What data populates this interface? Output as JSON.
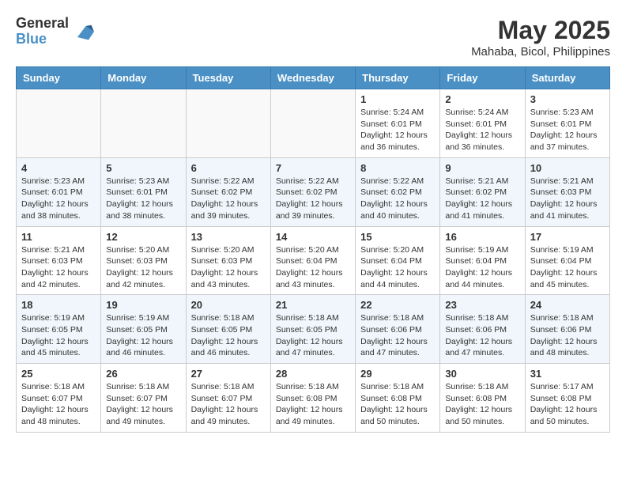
{
  "header": {
    "logo_general": "General",
    "logo_blue": "Blue",
    "month_title": "May 2025",
    "location": "Mahaba, Bicol, Philippines"
  },
  "weekdays": [
    "Sunday",
    "Monday",
    "Tuesday",
    "Wednesday",
    "Thursday",
    "Friday",
    "Saturday"
  ],
  "weeks": [
    [
      {
        "day": "",
        "info": ""
      },
      {
        "day": "",
        "info": ""
      },
      {
        "day": "",
        "info": ""
      },
      {
        "day": "",
        "info": ""
      },
      {
        "day": "1",
        "info": "Sunrise: 5:24 AM\nSunset: 6:01 PM\nDaylight: 12 hours\nand 36 minutes."
      },
      {
        "day": "2",
        "info": "Sunrise: 5:24 AM\nSunset: 6:01 PM\nDaylight: 12 hours\nand 36 minutes."
      },
      {
        "day": "3",
        "info": "Sunrise: 5:23 AM\nSunset: 6:01 PM\nDaylight: 12 hours\nand 37 minutes."
      }
    ],
    [
      {
        "day": "4",
        "info": "Sunrise: 5:23 AM\nSunset: 6:01 PM\nDaylight: 12 hours\nand 38 minutes."
      },
      {
        "day": "5",
        "info": "Sunrise: 5:23 AM\nSunset: 6:01 PM\nDaylight: 12 hours\nand 38 minutes."
      },
      {
        "day": "6",
        "info": "Sunrise: 5:22 AM\nSunset: 6:02 PM\nDaylight: 12 hours\nand 39 minutes."
      },
      {
        "day": "7",
        "info": "Sunrise: 5:22 AM\nSunset: 6:02 PM\nDaylight: 12 hours\nand 39 minutes."
      },
      {
        "day": "8",
        "info": "Sunrise: 5:22 AM\nSunset: 6:02 PM\nDaylight: 12 hours\nand 40 minutes."
      },
      {
        "day": "9",
        "info": "Sunrise: 5:21 AM\nSunset: 6:02 PM\nDaylight: 12 hours\nand 41 minutes."
      },
      {
        "day": "10",
        "info": "Sunrise: 5:21 AM\nSunset: 6:03 PM\nDaylight: 12 hours\nand 41 minutes."
      }
    ],
    [
      {
        "day": "11",
        "info": "Sunrise: 5:21 AM\nSunset: 6:03 PM\nDaylight: 12 hours\nand 42 minutes."
      },
      {
        "day": "12",
        "info": "Sunrise: 5:20 AM\nSunset: 6:03 PM\nDaylight: 12 hours\nand 42 minutes."
      },
      {
        "day": "13",
        "info": "Sunrise: 5:20 AM\nSunset: 6:03 PM\nDaylight: 12 hours\nand 43 minutes."
      },
      {
        "day": "14",
        "info": "Sunrise: 5:20 AM\nSunset: 6:04 PM\nDaylight: 12 hours\nand 43 minutes."
      },
      {
        "day": "15",
        "info": "Sunrise: 5:20 AM\nSunset: 6:04 PM\nDaylight: 12 hours\nand 44 minutes."
      },
      {
        "day": "16",
        "info": "Sunrise: 5:19 AM\nSunset: 6:04 PM\nDaylight: 12 hours\nand 44 minutes."
      },
      {
        "day": "17",
        "info": "Sunrise: 5:19 AM\nSunset: 6:04 PM\nDaylight: 12 hours\nand 45 minutes."
      }
    ],
    [
      {
        "day": "18",
        "info": "Sunrise: 5:19 AM\nSunset: 6:05 PM\nDaylight: 12 hours\nand 45 minutes."
      },
      {
        "day": "19",
        "info": "Sunrise: 5:19 AM\nSunset: 6:05 PM\nDaylight: 12 hours\nand 46 minutes."
      },
      {
        "day": "20",
        "info": "Sunrise: 5:18 AM\nSunset: 6:05 PM\nDaylight: 12 hours\nand 46 minutes."
      },
      {
        "day": "21",
        "info": "Sunrise: 5:18 AM\nSunset: 6:05 PM\nDaylight: 12 hours\nand 47 minutes."
      },
      {
        "day": "22",
        "info": "Sunrise: 5:18 AM\nSunset: 6:06 PM\nDaylight: 12 hours\nand 47 minutes."
      },
      {
        "day": "23",
        "info": "Sunrise: 5:18 AM\nSunset: 6:06 PM\nDaylight: 12 hours\nand 47 minutes."
      },
      {
        "day": "24",
        "info": "Sunrise: 5:18 AM\nSunset: 6:06 PM\nDaylight: 12 hours\nand 48 minutes."
      }
    ],
    [
      {
        "day": "25",
        "info": "Sunrise: 5:18 AM\nSunset: 6:07 PM\nDaylight: 12 hours\nand 48 minutes."
      },
      {
        "day": "26",
        "info": "Sunrise: 5:18 AM\nSunset: 6:07 PM\nDaylight: 12 hours\nand 49 minutes."
      },
      {
        "day": "27",
        "info": "Sunrise: 5:18 AM\nSunset: 6:07 PM\nDaylight: 12 hours\nand 49 minutes."
      },
      {
        "day": "28",
        "info": "Sunrise: 5:18 AM\nSunset: 6:08 PM\nDaylight: 12 hours\nand 49 minutes."
      },
      {
        "day": "29",
        "info": "Sunrise: 5:18 AM\nSunset: 6:08 PM\nDaylight: 12 hours\nand 50 minutes."
      },
      {
        "day": "30",
        "info": "Sunrise: 5:18 AM\nSunset: 6:08 PM\nDaylight: 12 hours\nand 50 minutes."
      },
      {
        "day": "31",
        "info": "Sunrise: 5:17 AM\nSunset: 6:08 PM\nDaylight: 12 hours\nand 50 minutes."
      }
    ]
  ]
}
